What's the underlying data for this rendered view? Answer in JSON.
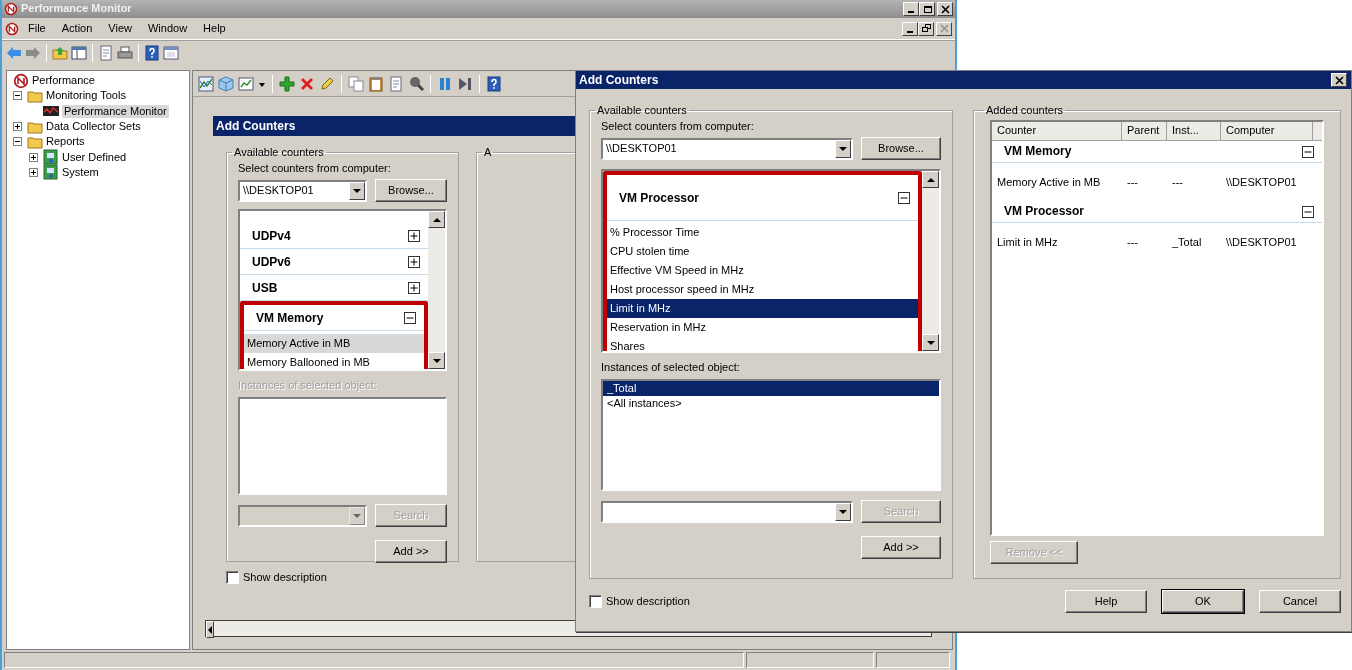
{
  "window": {
    "title": "Performance Monitor"
  },
  "menu": [
    {
      "label": "File"
    },
    {
      "label": "Action"
    },
    {
      "label": "View"
    },
    {
      "label": "Window"
    },
    {
      "label": "Help"
    }
  ],
  "tree": [
    {
      "label": "Performance",
      "kind": "root",
      "selected": false,
      "children": [
        {
          "label": "Monitoring Tools",
          "kind": "folder",
          "expanded": true,
          "selected": false,
          "children": [
            {
              "label": "Performance Monitor",
              "kind": "monitor",
              "selected": true
            }
          ]
        },
        {
          "label": "Data Collector Sets",
          "kind": "folder",
          "expanded": false,
          "selected": false
        },
        {
          "label": "Reports",
          "kind": "folder",
          "expanded": true,
          "selected": false,
          "children": [
            {
              "label": "User Defined",
              "kind": "report",
              "expanded": false,
              "selected": false
            },
            {
              "label": "System",
              "kind": "report",
              "expanded": false,
              "selected": false
            }
          ]
        }
      ]
    }
  ],
  "inner_dialog": {
    "title": "Add Counters",
    "active": false,
    "available_counters": {
      "legend": "Available counters",
      "computer_label": "Select counters from computer:",
      "computer_value": "\\\\DESKTOP01",
      "browse_button": "Browse...",
      "counter_groups": [
        {
          "name": "UDPv4",
          "expanded": false,
          "highlighted": false
        },
        {
          "name": "UDPv6",
          "expanded": false,
          "highlighted": false
        },
        {
          "name": "USB",
          "expanded": false,
          "highlighted": false
        },
        {
          "name": "VM Memory",
          "expanded": true,
          "highlighted": true,
          "counters": [
            {
              "label": "Memory Active in MB",
              "selected": true
            },
            {
              "label": "Memory Ballooned in MB",
              "selected": false
            }
          ]
        }
      ],
      "instances_label": {
        "text": "Instances of selected object:",
        "disabled": true
      },
      "search_field": {
        "disabled": true
      },
      "search_button": {
        "label": "Search",
        "disabled": true
      },
      "add_button": "Add >>"
    },
    "show_description": {
      "label": "Show description",
      "checked": false
    },
    "added_counters": {
      "legend": "A"
    }
  },
  "dialog": {
    "title": "Add Counters",
    "active": true,
    "available_counters": {
      "legend": "Available counters",
      "computer_label": "Select counters from computer:",
      "computer_value": "\\\\DESKTOP01",
      "browse_button": "Browse...",
      "counter_groups": [
        {
          "name": "VM Processor",
          "expanded": true,
          "highlighted": true,
          "counters": [
            {
              "label": "% Processor Time",
              "selected": false
            },
            {
              "label": "CPU stolen time",
              "selected": false
            },
            {
              "label": "Effective VM Speed in MHz",
              "selected": false
            },
            {
              "label": "Host processor speed in MHz",
              "selected": false
            },
            {
              "label": "Limit in MHz",
              "selected": true
            },
            {
              "label": "Reservation in MHz",
              "selected": false
            },
            {
              "label": "Shares",
              "selected": false
            }
          ]
        }
      ],
      "instances_label": {
        "text": "Instances of selected object:",
        "disabled": false
      },
      "instances": [
        {
          "label": "_Total",
          "selected": true
        },
        {
          "label": "<All instances>",
          "selected": false
        }
      ],
      "search_field": {
        "disabled": false
      },
      "search_button": {
        "label": "Search",
        "disabled": true
      },
      "add_button": "Add >>"
    },
    "added_counters": {
      "legend": "Added counters",
      "columns": [
        "Counter",
        "Parent",
        "Inst...",
        "Computer"
      ],
      "groups": [
        {
          "name": "VM Memory",
          "expanded": true,
          "rows": [
            [
              "Memory Active in MB",
              "---",
              "---",
              "\\\\DESKTOP01"
            ]
          ]
        },
        {
          "name": "VM Processor",
          "expanded": true,
          "rows": [
            [
              "Limit in MHz",
              "---",
              "_Total",
              "\\\\DESKTOP01"
            ]
          ]
        }
      ],
      "remove_button": {
        "label": "Remove <<",
        "disabled": true
      }
    },
    "show_description": {
      "label": "Show description",
      "checked": false
    },
    "buttons": [
      {
        "label": "Help",
        "default": false
      },
      {
        "label": "OK",
        "default": true
      },
      {
        "label": "Cancel",
        "default": false
      }
    ]
  }
}
